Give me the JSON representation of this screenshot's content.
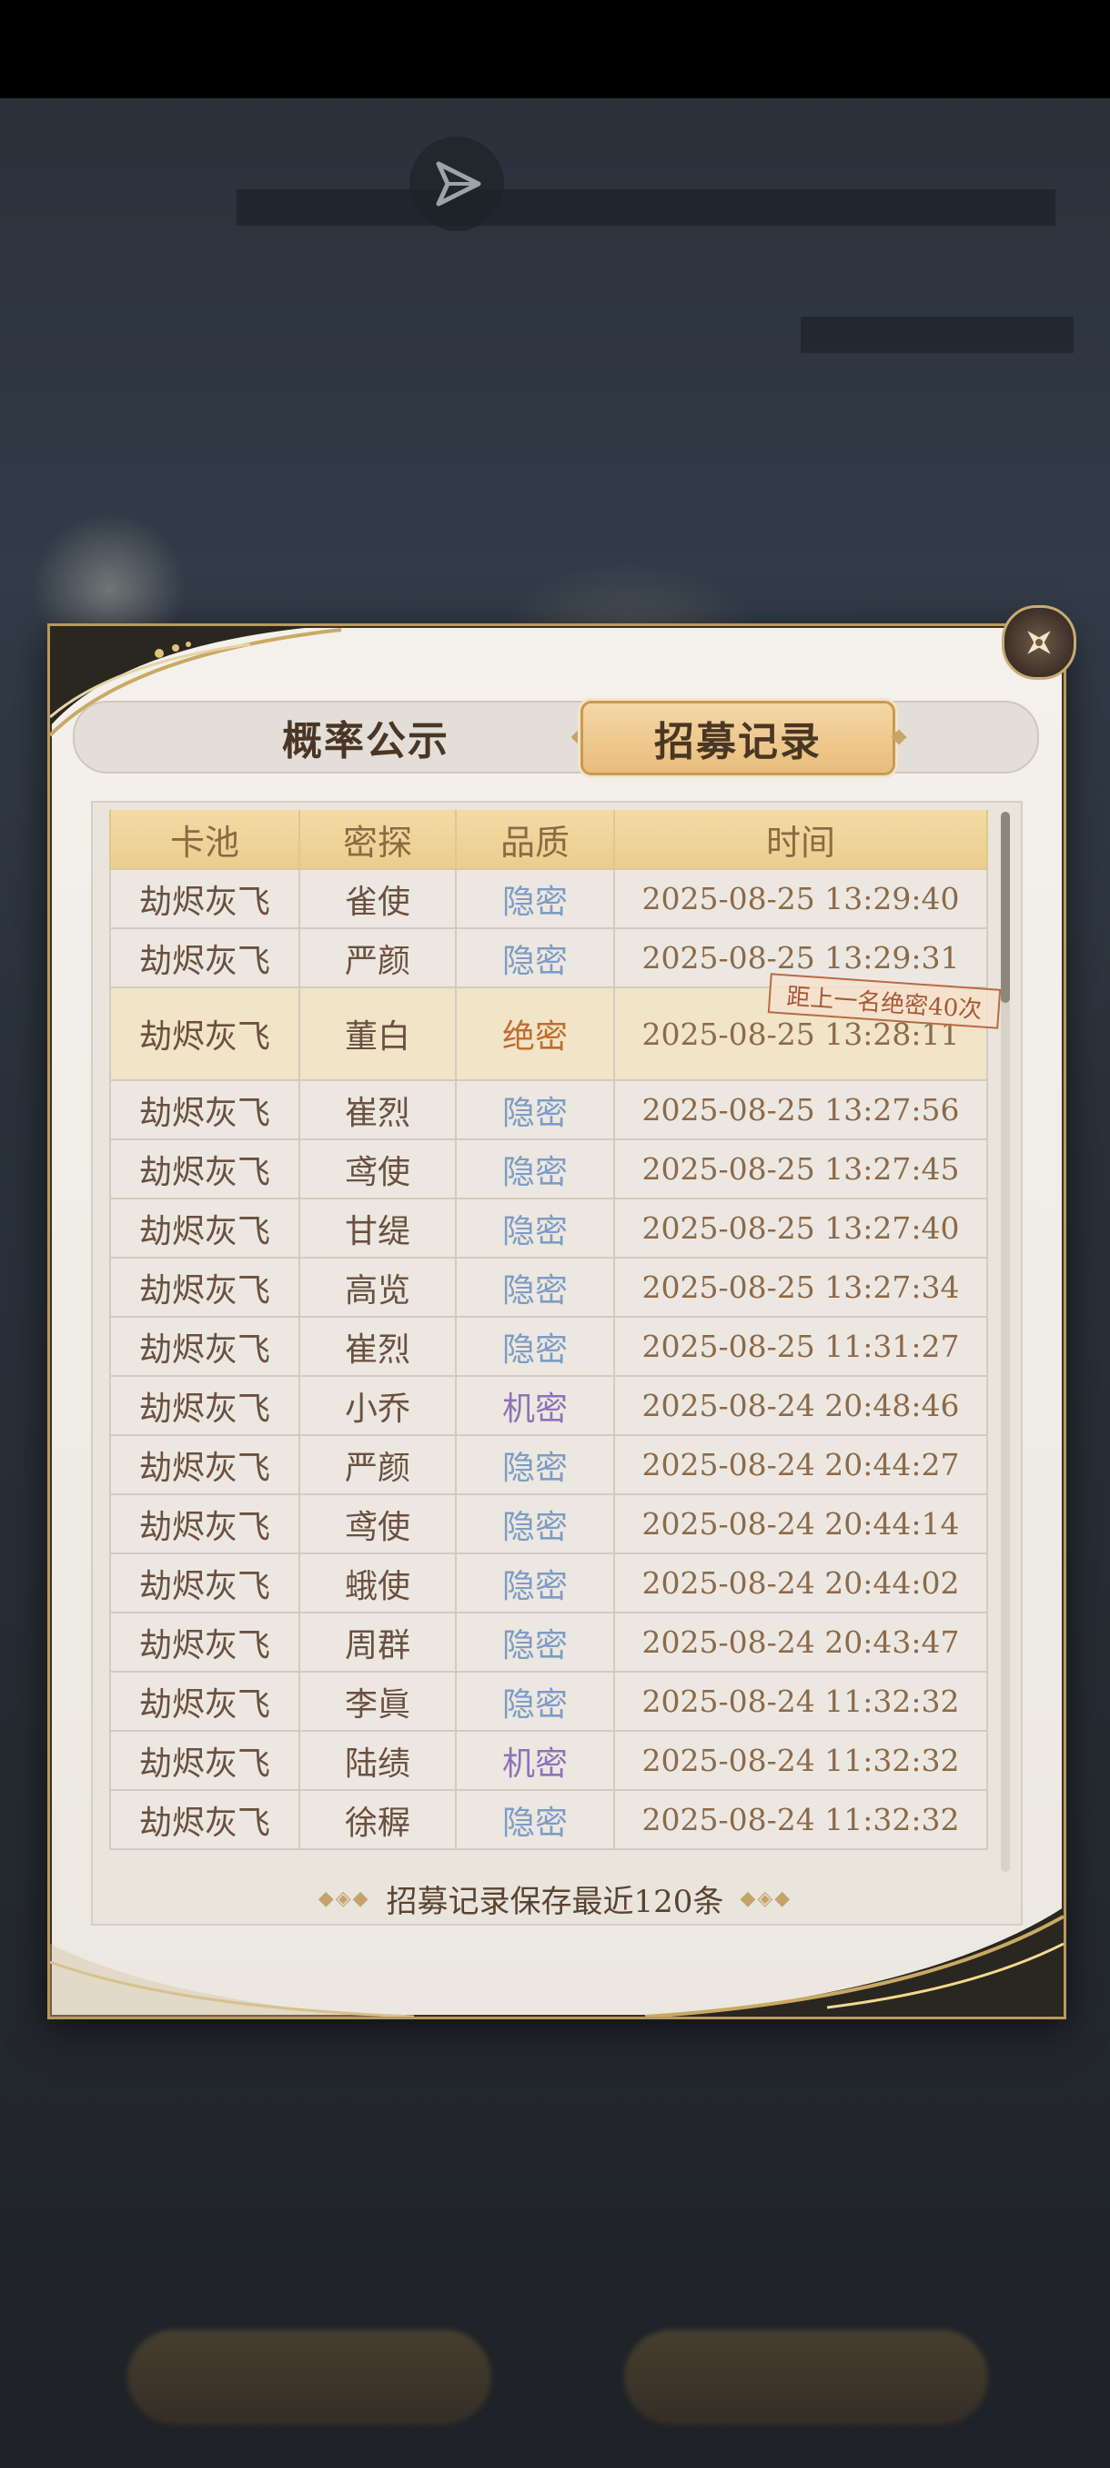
{
  "tabs": {
    "probability": "概率公示",
    "records": "招募记录"
  },
  "table": {
    "headers": [
      "卡池",
      "密探",
      "品质",
      "时间"
    ],
    "rows": [
      {
        "pool": "劫烬灰飞",
        "agent": "雀使",
        "quality": "隐密",
        "time": "2025-08-25 13:29:40"
      },
      {
        "pool": "劫烬灰飞",
        "agent": "严颜",
        "quality": "隐密",
        "time": "2025-08-25 13:29:31"
      },
      {
        "pool": "劫烬灰飞",
        "agent": "董白",
        "quality": "绝密",
        "time": "2025-08-25 13:28:11"
      },
      {
        "pool": "劫烬灰飞",
        "agent": "崔烈",
        "quality": "隐密",
        "time": "2025-08-25 13:27:56"
      },
      {
        "pool": "劫烬灰飞",
        "agent": "鸢使",
        "quality": "隐密",
        "time": "2025-08-25 13:27:45"
      },
      {
        "pool": "劫烬灰飞",
        "agent": "甘缇",
        "quality": "隐密",
        "time": "2025-08-25 13:27:40"
      },
      {
        "pool": "劫烬灰飞",
        "agent": "高览",
        "quality": "隐密",
        "time": "2025-08-25 13:27:34"
      },
      {
        "pool": "劫烬灰飞",
        "agent": "崔烈",
        "quality": "隐密",
        "time": "2025-08-25 11:31:27"
      },
      {
        "pool": "劫烬灰飞",
        "agent": "小乔",
        "quality": "机密",
        "time": "2025-08-24 20:48:46"
      },
      {
        "pool": "劫烬灰飞",
        "agent": "严颜",
        "quality": "隐密",
        "time": "2025-08-24 20:44:27"
      },
      {
        "pool": "劫烬灰飞",
        "agent": "鸢使",
        "quality": "隐密",
        "time": "2025-08-24 20:44:14"
      },
      {
        "pool": "劫烬灰飞",
        "agent": "蛾使",
        "quality": "隐密",
        "time": "2025-08-24 20:44:02"
      },
      {
        "pool": "劫烬灰飞",
        "agent": "周群",
        "quality": "隐密",
        "time": "2025-08-24 20:43:47"
      },
      {
        "pool": "劫烬灰飞",
        "agent": "李眞",
        "quality": "隐密",
        "time": "2025-08-24 11:32:32"
      },
      {
        "pool": "劫烬灰飞",
        "agent": "陆绩",
        "quality": "机密",
        "time": "2025-08-24 11:32:32"
      },
      {
        "pool": "劫烬灰飞",
        "agent": "徐稺",
        "quality": "隐密",
        "time": "2025-08-24 11:32:32"
      }
    ]
  },
  "stamp": "距上一名绝密40次",
  "footer_note": "招募记录保存最近120条",
  "icons": {
    "share": "share-icon",
    "close": "close-icon"
  },
  "colors": {
    "quality_yinmi": "#7e9cc4",
    "quality_jimi": "#8e72b8",
    "quality_juemi": "#c06d2e",
    "header_bg": "#eacd8e",
    "tab_active": "#e8bd7c"
  }
}
